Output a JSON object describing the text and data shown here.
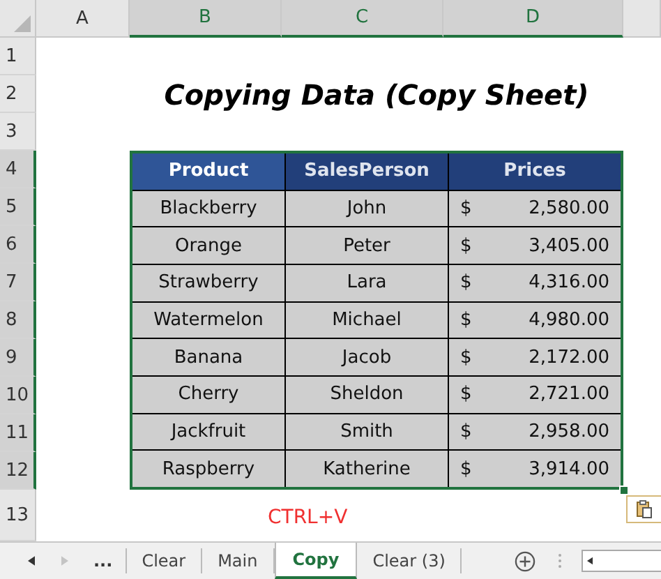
{
  "column_headers": [
    {
      "label": "A",
      "selected": false
    },
    {
      "label": "B",
      "selected": true
    },
    {
      "label": "C",
      "selected": true
    },
    {
      "label": "D",
      "selected": true
    }
  ],
  "row_headers": [
    {
      "label": "1",
      "selected": false
    },
    {
      "label": "2",
      "selected": false
    },
    {
      "label": "3",
      "selected": false
    },
    {
      "label": "4",
      "selected": true
    },
    {
      "label": "5",
      "selected": true
    },
    {
      "label": "6",
      "selected": true
    },
    {
      "label": "7",
      "selected": true
    },
    {
      "label": "8",
      "selected": true
    },
    {
      "label": "9",
      "selected": true
    },
    {
      "label": "10",
      "selected": true
    },
    {
      "label": "11",
      "selected": true
    },
    {
      "label": "12",
      "selected": true
    },
    {
      "label": "13",
      "selected": false
    }
  ],
  "title": "Copying Data (Copy Sheet)",
  "table": {
    "columns": [
      "Product",
      "SalesPerson",
      "Prices"
    ],
    "rows": [
      {
        "product": "Blackberry",
        "salesperson": "John",
        "currency": "$",
        "price": "2,580.00"
      },
      {
        "product": "Orange",
        "salesperson": "Peter",
        "currency": "$",
        "price": "3,405.00"
      },
      {
        "product": "Strawberry",
        "salesperson": "Lara",
        "currency": "$",
        "price": "4,316.00"
      },
      {
        "product": "Watermelon",
        "salesperson": "Michael",
        "currency": "$",
        "price": "4,980.00"
      },
      {
        "product": "Banana",
        "salesperson": "Jacob",
        "currency": "$",
        "price": "2,172.00"
      },
      {
        "product": "Cherry",
        "salesperson": "Sheldon",
        "currency": "$",
        "price": "2,721.00"
      },
      {
        "product": "Jackfruit",
        "salesperson": "Smith",
        "currency": "$",
        "price": "2,958.00"
      },
      {
        "product": "Raspberry",
        "salesperson": "Katherine",
        "currency": "$",
        "price": "3,914.00"
      }
    ]
  },
  "note": "CTRL+V",
  "sheet_tabs": {
    "more": "...",
    "tabs": [
      {
        "label": "Clear",
        "selected": false
      },
      {
        "label": "Main",
        "selected": false
      },
      {
        "label": "Copy",
        "selected": true
      },
      {
        "label": "Clear (3)",
        "selected": false
      }
    ]
  }
}
